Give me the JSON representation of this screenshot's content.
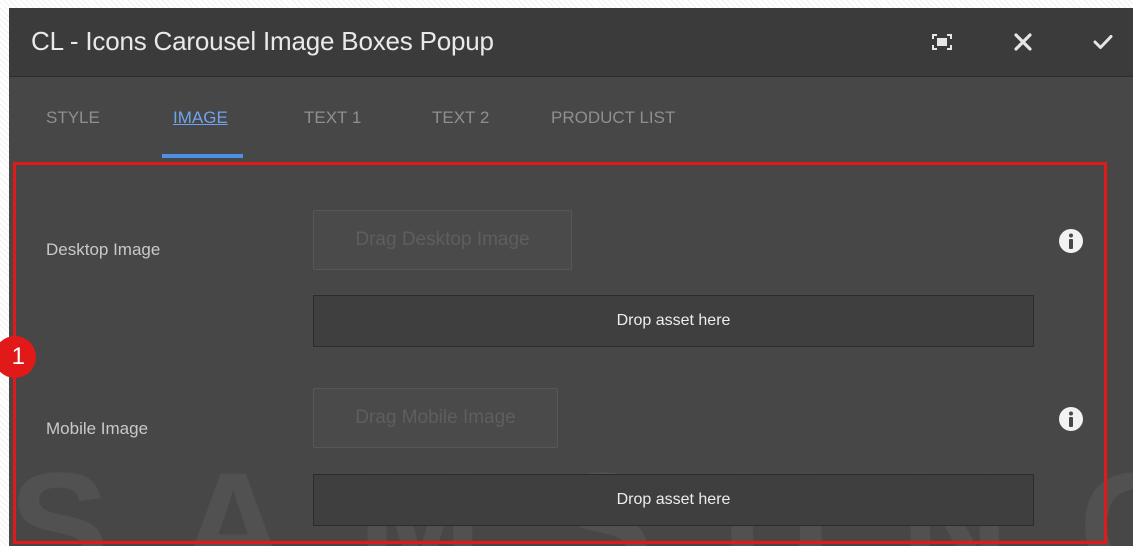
{
  "dialog": {
    "title": "CL - Icons Carousel Image Boxes Popup",
    "actions": [
      {
        "name": "fullscreen-icon"
      },
      {
        "name": "close-icon"
      },
      {
        "name": "checkmark-icon"
      }
    ]
  },
  "tabs": [
    {
      "label": "STYLE",
      "active": false
    },
    {
      "label": "IMAGE",
      "active": true
    },
    {
      "label": "TEXT 1",
      "active": false
    },
    {
      "label": "TEXT 2",
      "active": false
    },
    {
      "label": "PRODUCT LIST",
      "active": false
    }
  ],
  "fields": {
    "desktop": {
      "label": "Desktop Image",
      "drag_label": "Drag Desktop Image",
      "drop_label": "Drop asset here",
      "info_icon": "info-icon"
    },
    "mobile": {
      "label": "Mobile Image",
      "drag_label": "Drag Mobile Image",
      "drop_label": "Drop asset here",
      "info_icon": "info-icon"
    }
  },
  "annotation": {
    "marker_number": "1",
    "color": "#e21919"
  },
  "watermark": {
    "text": "SAMSUNG"
  },
  "colors": {
    "titlebar": "#3b3b3b",
    "panel": "#474747",
    "active_tab": "#6fa3ee",
    "tab_indicator": "#4f8fe8"
  }
}
